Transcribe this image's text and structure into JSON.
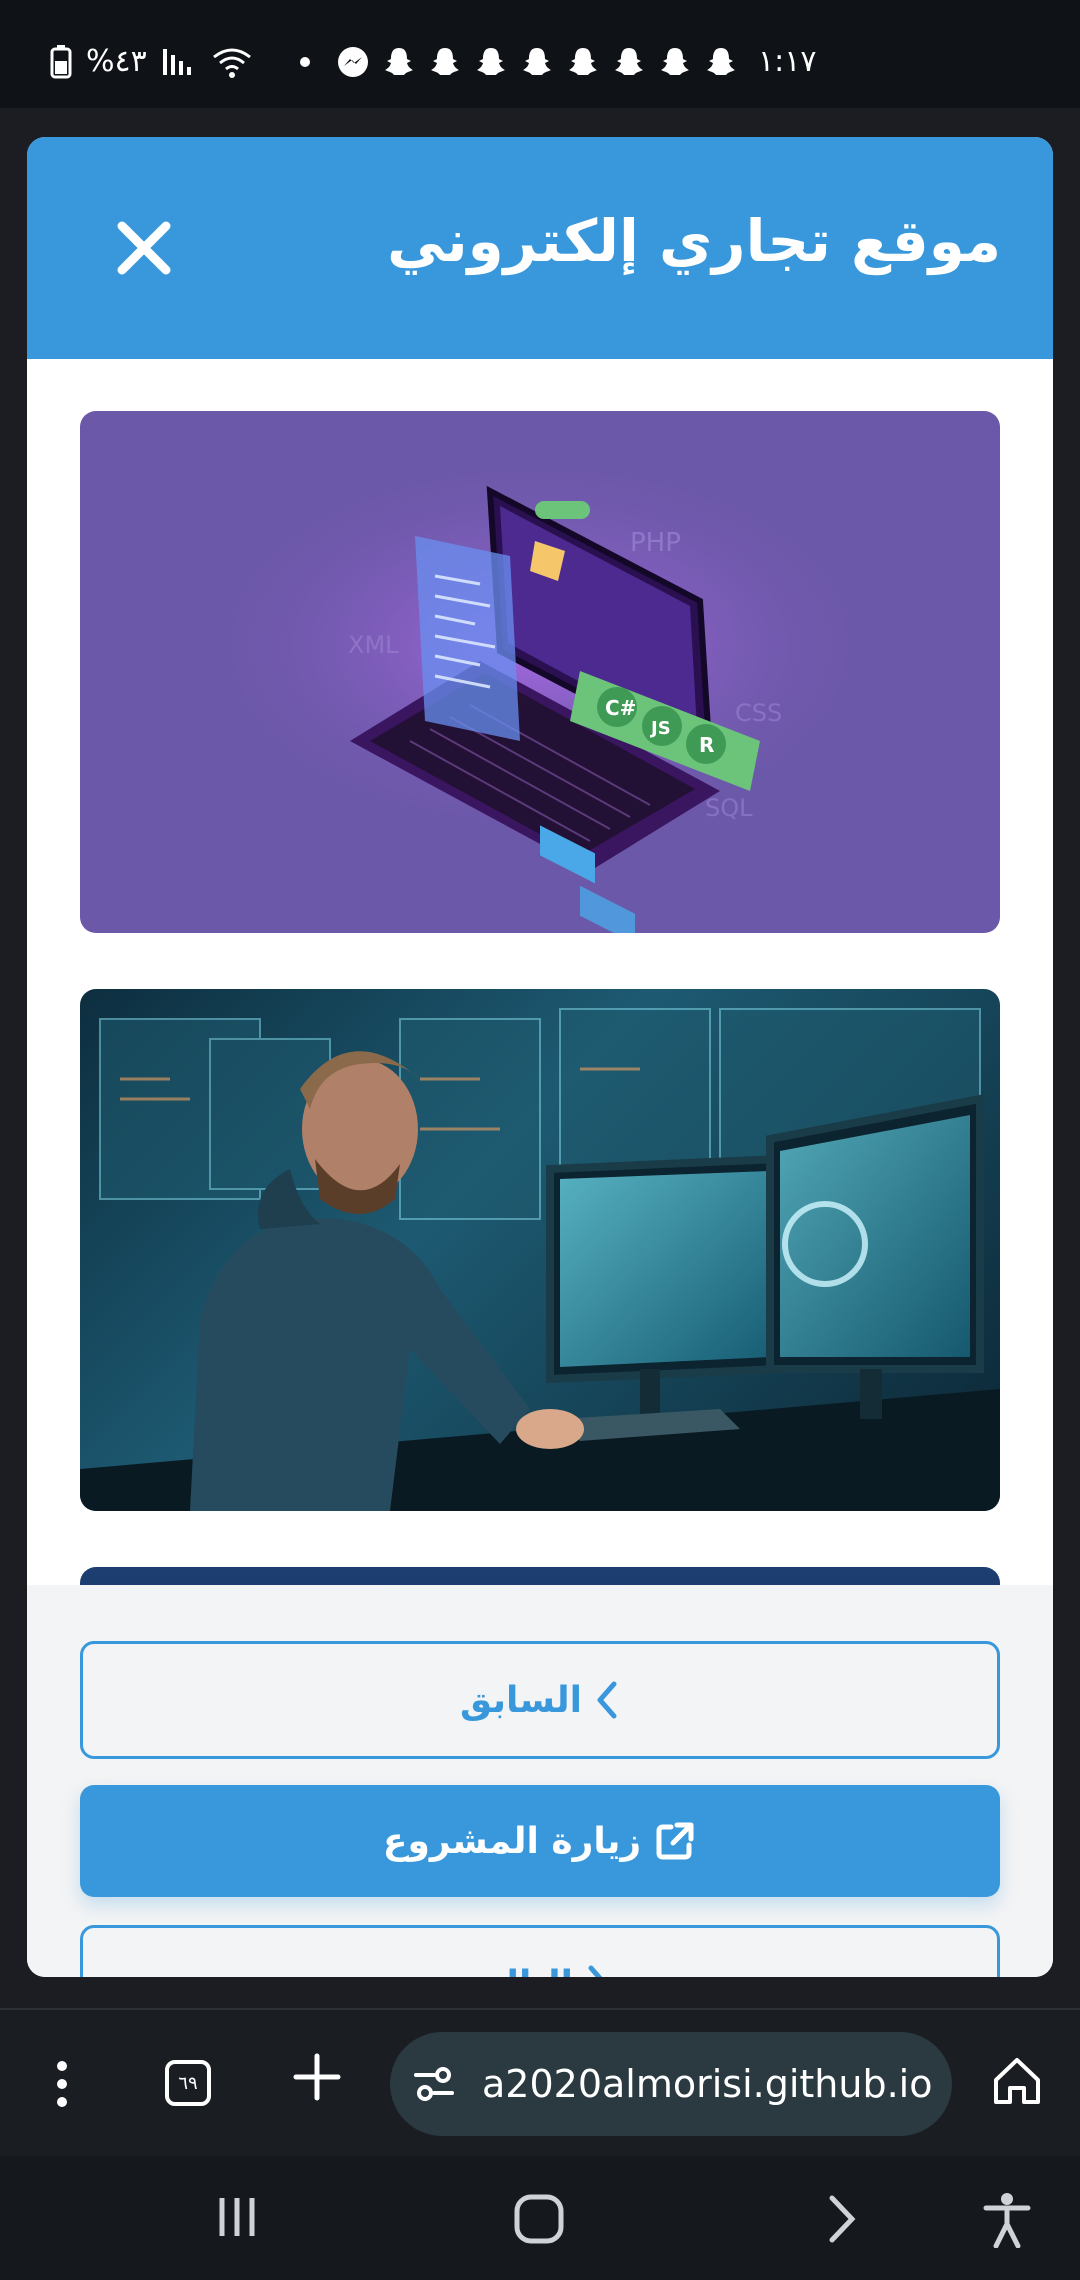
{
  "status_bar": {
    "time": "١:١٧",
    "battery": "%٤٣"
  },
  "dialog": {
    "title": "موقع تجاري إلكتروني",
    "images": [
      {
        "alt": "code-laptop-illustration"
      },
      {
        "alt": "developer-at-monitors"
      },
      {
        "alt": "partial-third-image"
      }
    ],
    "prev_label": "السابق",
    "visit_label": "زيارة المشروع",
    "next_label": "التالي"
  },
  "browser": {
    "url": "a2020almorisi.github.io",
    "tab_count": "٦٩"
  },
  "colors": {
    "accent": "#3898db",
    "header_bg": "#3898db",
    "footer_bg": "#f3f4f5"
  }
}
